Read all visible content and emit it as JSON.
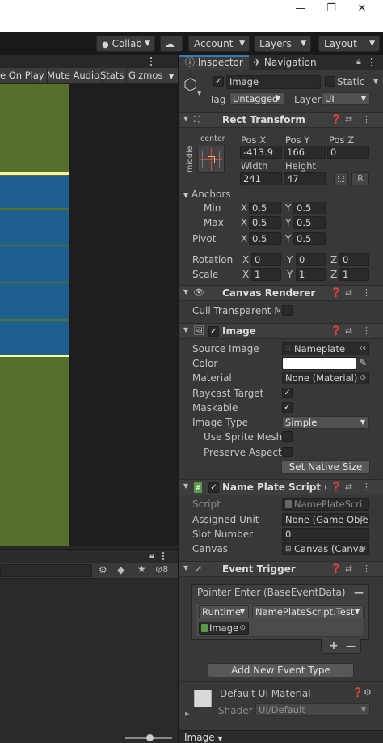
{
  "window": {
    "minimize": "—",
    "maximize": "❐",
    "close": "✕"
  },
  "toolbar": {
    "collab": "Collab",
    "account": "Account",
    "layers": "Layers",
    "layout": "Layout"
  },
  "game": {
    "buttons": [
      "e On Play",
      "Mute Audio",
      "Stats",
      "Gizmos"
    ]
  },
  "bottom": {
    "hidden_count": "8"
  },
  "inspector": {
    "tabs": {
      "inspector": "Inspector",
      "navigation": "Navigation"
    },
    "object": {
      "name": "Image",
      "static_label": "Static",
      "tag_label": "Tag",
      "tag_value": "Untagged",
      "layer_label": "Layer",
      "layer_value": "UI",
      "active": true
    },
    "rect_transform": {
      "title": "Rect Transform",
      "anchor_h": "center",
      "anchor_v": "middle",
      "pos_x_label": "Pos X",
      "pos_y_label": "Pos Y",
      "pos_z_label": "Pos Z",
      "pos_x": "-413.9",
      "pos_y": "166",
      "pos_z": "0",
      "width_label": "Width",
      "height_label": "Height",
      "width": "241",
      "height": "47",
      "r_button": "R",
      "anchors_label": "Anchors",
      "min_label": "Min",
      "min_x": "0.5",
      "min_y": "0.5",
      "max_label": "Max",
      "max_x": "0.5",
      "max_y": "0.5",
      "pivot_label": "Pivot",
      "pivot_x": "0.5",
      "pivot_y": "0.5",
      "rotation_label": "Rotation",
      "rot_x": "0",
      "rot_y": "0",
      "rot_z": "0",
      "scale_label": "Scale",
      "scale_x": "1",
      "scale_y": "1",
      "scale_z": "1"
    },
    "canvas_renderer": {
      "title": "Canvas Renderer",
      "cull_label": "Cull Transparent Mes",
      "cull": false
    },
    "image": {
      "title": "Image",
      "source_label": "Source Image",
      "source_value": "Nameplate",
      "color_label": "Color",
      "color_value": "#ffffff",
      "material_label": "Material",
      "material_value": "None (Material)",
      "raycast_label": "Raycast Target",
      "raycast": true,
      "maskable_label": "Maskable",
      "maskable": true,
      "type_label": "Image Type",
      "type_value": "Simple",
      "sprite_mesh_label": "Use Sprite Mesh",
      "sprite_mesh": false,
      "preserve_label": "Preserve Aspect",
      "preserve": false,
      "native_size_button": "Set Native Size"
    },
    "name_plate": {
      "title": "Name Plate Script (Scri",
      "script_label": "Script",
      "script_value": "NamePlateScri",
      "unit_label": "Assigned Unit",
      "unit_value": "None (Game Obje",
      "slot_label": "Slot Number",
      "slot_value": "0",
      "canvas_label": "Canvas",
      "canvas_value": "Canvas (Canva"
    },
    "event_trigger": {
      "title": "Event Trigger",
      "entry_title": "Pointer Enter (BaseEventData)",
      "remove": "—",
      "runtime": "Runtime",
      "function": "NamePlateScript.Test",
      "target": "Image",
      "add": "+",
      "minus": "—",
      "add_event_button": "Add New Event Type"
    },
    "material": {
      "name": "Default UI Material",
      "shader_label": "Shader",
      "shader_value": "UI/Default"
    },
    "footer": {
      "label": "Image"
    }
  },
  "colors": {
    "field_bg": "#2a2a2a",
    "panel_bg": "#383838",
    "scene_green": "#566f2b",
    "scene_blue": "#1d5f8e"
  }
}
